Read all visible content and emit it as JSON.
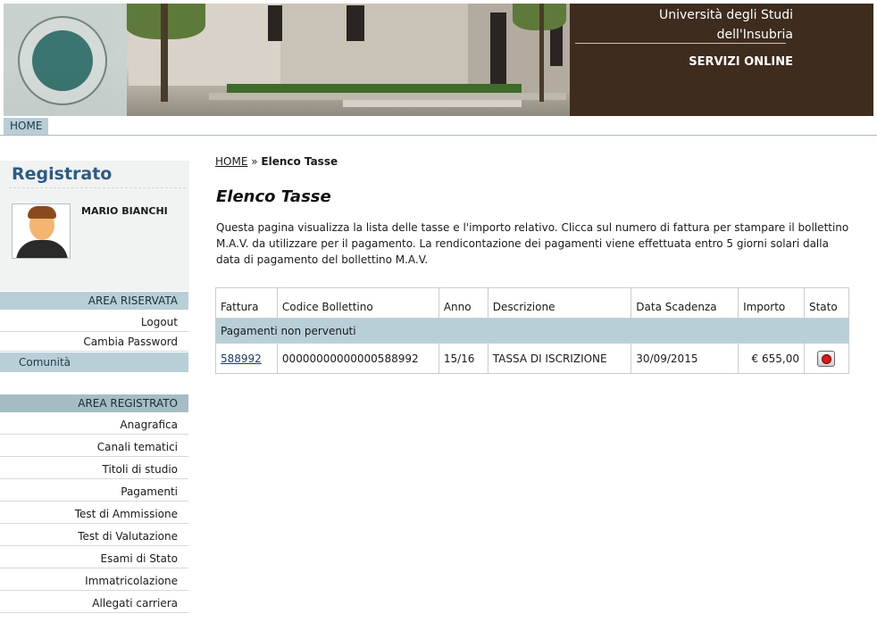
{
  "header": {
    "university_line1": "Università degli Studi",
    "university_line2": "dell'Insubria",
    "service": "SERVIZI ONLINE"
  },
  "nav": {
    "home": "HOME"
  },
  "sidebar": {
    "title": "Registrato",
    "user_name": "MARIO BIANCHI",
    "section_reserved": "AREA RISERVATA",
    "reserved_items": [
      {
        "label": "Logout"
      },
      {
        "label": "Cambia Password"
      },
      {
        "label": "Comunità"
      }
    ],
    "section_registered": "AREA REGISTRATO",
    "registered_items": [
      {
        "label": "Anagrafica"
      },
      {
        "label": "Canali tematici"
      },
      {
        "label": "Titoli di studio"
      },
      {
        "label": "Pagamenti"
      },
      {
        "label": "Test di Ammissione"
      },
      {
        "label": "Test di Valutazione"
      },
      {
        "label": "Esami di Stato"
      },
      {
        "label": "Immatricolazione"
      },
      {
        "label": "Allegati carriera"
      }
    ]
  },
  "main": {
    "breadcrumb_home": "HOME",
    "breadcrumb_sep": "»",
    "breadcrumb_current": "Elenco Tasse",
    "title": "Elenco Tasse",
    "intro": "Questa pagina visualizza la lista delle tasse e l'importo relativo. Clicca sul numero di fattura per stampare il bollettino M.A.V. da utilizzare per il pagamento. La rendicontazione dei pagamenti viene effettuata entro 5 giorni solari dalla data di pagamento del bollettino M.A.V.",
    "table": {
      "headers": [
        "Fattura",
        "Codice Bollettino",
        "Anno",
        "Descrizione",
        "Data Scadenza",
        "Importo",
        "Stato"
      ],
      "group_label": "Pagamenti non pervenuti",
      "rows": [
        {
          "fattura": "588992",
          "codice": "00000000000000588992",
          "anno": "15/16",
          "descrizione": "TASSA DI ISCRIZIONE",
          "scadenza": "30/09/2015",
          "importo": "€ 655,00",
          "stato_icon": "red-semaphore-icon"
        }
      ]
    }
  }
}
